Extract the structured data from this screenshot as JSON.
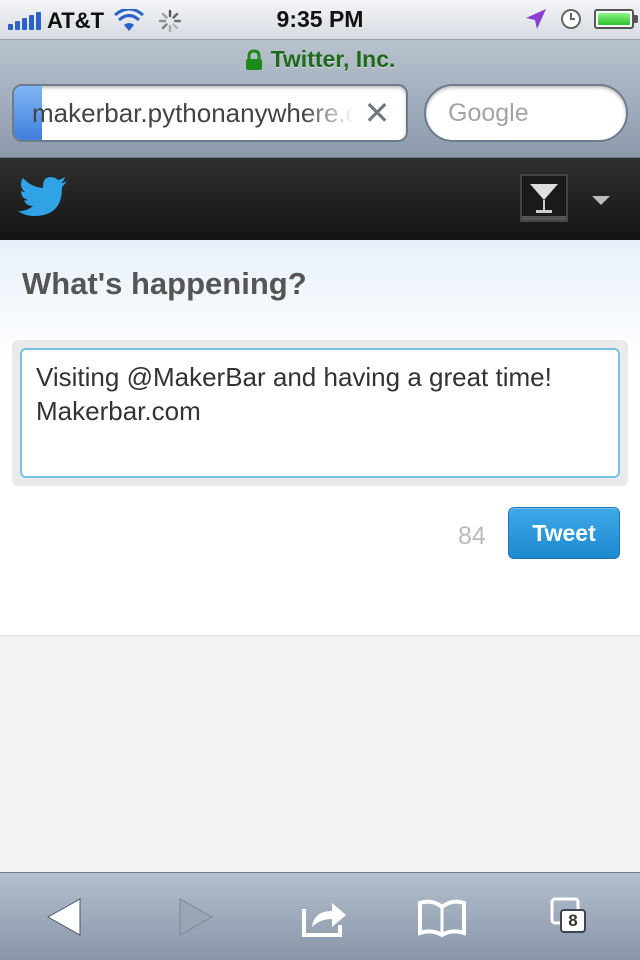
{
  "status_bar": {
    "carrier": "AT&T",
    "time": "9:35 PM"
  },
  "browser": {
    "page_title": "Twitter, Inc.",
    "url": "makerbar.pythonanywhere.com",
    "search_placeholder": "Google",
    "tab_count": "8"
  },
  "compose": {
    "heading": "What's happening?",
    "tweet_line1": "Visiting @MakerBar and having a great time!",
    "tweet_line2": "Makerbar.com",
    "char_count": "84",
    "tweet_button": "Tweet"
  },
  "colors": {
    "twitter_blue": "#1d89cf",
    "secure_green": "#1d6a1b"
  }
}
